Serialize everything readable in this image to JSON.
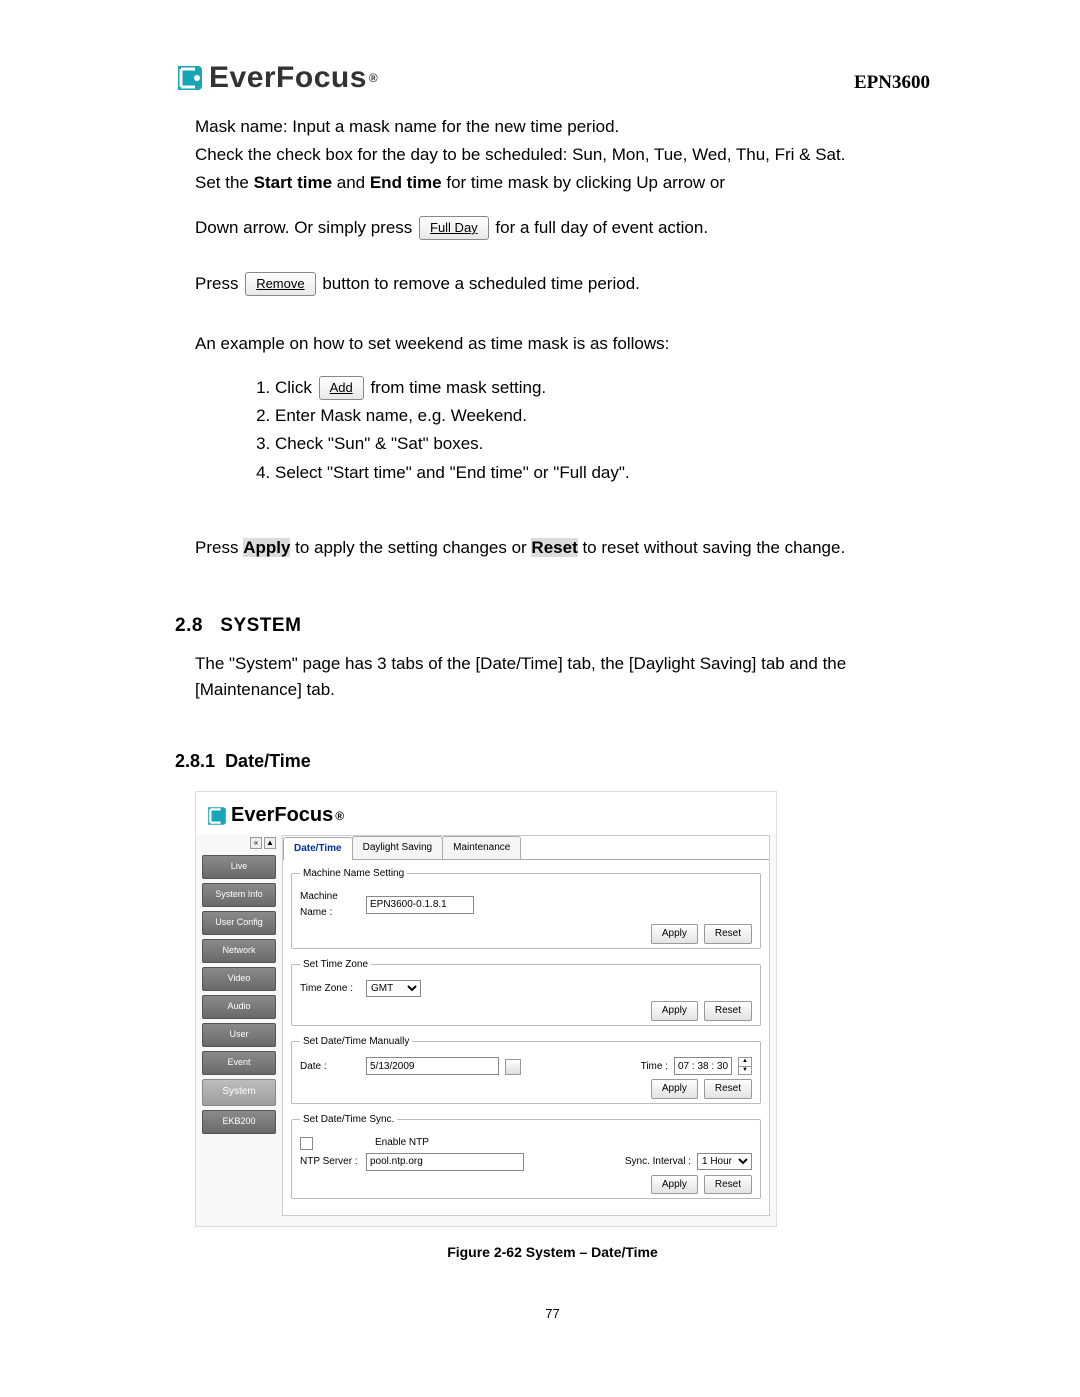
{
  "header": {
    "brand": "EverFocus",
    "model": "EPN3600"
  },
  "buttons_inline": {
    "full_day": "Full Day",
    "remove": "Remove",
    "add": "Add"
  },
  "text": {
    "p1": "Mask name: Input a mask name for the new time period.",
    "p2": "Check the check box for the day to be scheduled: Sun, Mon, Tue, Wed, Thu, Fri & Sat.",
    "p3a": "Set the ",
    "p3b": "Start time",
    "p3c": " and ",
    "p3d": "End time",
    "p3e": " for time mask by clicking Up arrow or",
    "p4a": "Down arrow. Or simply press ",
    "p4b": " for a full day of event action.",
    "p5a": "Press ",
    "p5b": " button to remove a scheduled time period.",
    "p6": "An example on how to set weekend as time mask is as follows:",
    "li1a": "Click ",
    "li1b": " from time mask setting.",
    "li2": "Enter Mask name, e.g. Weekend.",
    "li3": "Check \"Sun\" & \"Sat\" boxes.",
    "li4": "Select \"Start time\" and \"End time\" or \"Full day\".",
    "p7a": "Press ",
    "p7apply": "Apply",
    "p7b": " to apply the setting changes or ",
    "p7reset": "Reset",
    "p7c": " to reset without saving the change."
  },
  "sections": {
    "s28_num": "2.8",
    "s28_title": "SYSTEM",
    "s28_body": "The \"System\" page has 3 tabs of the [Date/Time] tab, the [Daylight Saving] tab and the [Maintenance] tab.",
    "s281_num": "2.8.1",
    "s281_title": "Date/Time"
  },
  "shot": {
    "brand": "EverFocus",
    "side": [
      "Live",
      "System Info",
      "User Config",
      "Network",
      "Video",
      "Audio",
      "User",
      "Event",
      "System",
      "EKB200"
    ],
    "side_selected_index": 8,
    "tabs": [
      "Date/Time",
      "Daylight Saving",
      "Maintenance"
    ],
    "tab_selected_index": 0,
    "fs1": {
      "legend": "Machine Name Setting",
      "lbl": "Machine Name :",
      "val": "EPN3600-0.1.8.1"
    },
    "fs2": {
      "legend": "Set Time Zone",
      "lbl": "Time Zone :",
      "val": "GMT"
    },
    "fs3": {
      "legend": "Set Date/Time Manually",
      "date_lbl": "Date :",
      "date_val": "5/13/2009",
      "time_lbl": "Time :",
      "time_val": "07 : 38 : 30"
    },
    "fs4": {
      "legend": "Set Date/Time Sync.",
      "enable_lbl": "Enable NTP",
      "ntp_lbl": "NTP Server :",
      "ntp_val": "pool.ntp.org",
      "int_lbl": "Sync. Interval :",
      "int_val": "1 Hour"
    },
    "btn_apply": "Apply",
    "btn_reset": "Reset"
  },
  "figure_caption": "Figure 2-62 System – Date/Time",
  "page_number": "77"
}
